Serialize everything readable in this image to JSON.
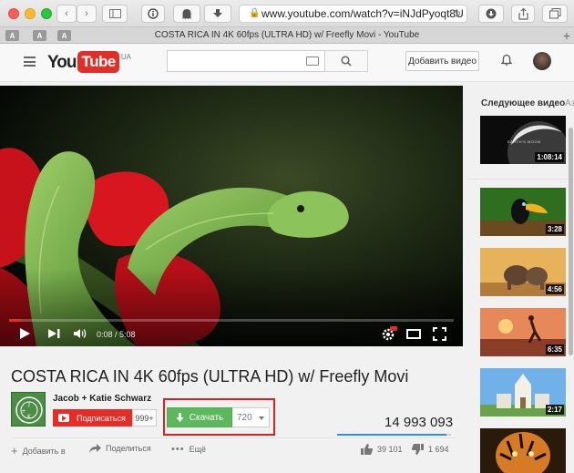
{
  "browser": {
    "url": "www.youtube.com/watch?v=iNJdPyoqt8U",
    "tab_title": "COSTA RICA IN 4K 60fps (ULTRA HD) w/ Freefly Movi - YouTube",
    "tab_buttons": [
      "A",
      "A",
      "A"
    ],
    "new_tab": "+"
  },
  "header": {
    "logo_you": "You",
    "logo_tube": "Tube",
    "logo_region": "UA",
    "search_placeholder": "",
    "add_video_label": "Добавить видео"
  },
  "player": {
    "time": "0:08 / 5:08",
    "progress_fraction": 0.026
  },
  "video": {
    "title": "COSTA RICA IN 4K 60fps (ULTRA HD) w/ Freefly Movi",
    "channel_name": "Jacob + Katie Schwarz",
    "subscribe_label": "Подписаться",
    "subscriber_count": "999+",
    "download_label": "Скачать",
    "quality": "720",
    "views": "14 993 093",
    "like_ratio": 0.959
  },
  "actions": {
    "add_to": "Добавить в",
    "share": "Поделиться",
    "more": "Ещё",
    "likes": "39 101",
    "dislikes": "1 694"
  },
  "sidebar": {
    "next_title": "Следующее видео",
    "next_aside": "Аз",
    "items": [
      {
        "duration": "1:08:14",
        "thumb_text": "EARTH'S MOON"
      },
      {
        "duration": "3:28"
      },
      {
        "duration": "4:56"
      },
      {
        "duration": "6:35"
      },
      {
        "duration": "2:17"
      },
      {
        "duration": ""
      }
    ]
  },
  "colors": {
    "youtube_red": "#e52d27",
    "download_green": "#5cb85c",
    "highlight_red": "#e0201f",
    "views_bar": "#2793e6"
  }
}
